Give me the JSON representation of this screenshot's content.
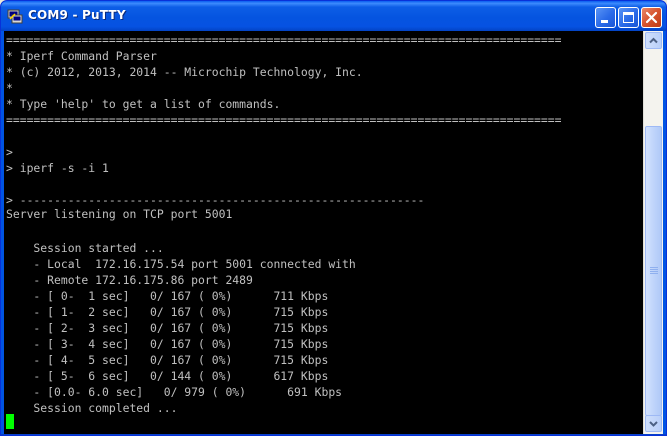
{
  "window": {
    "title": "COM9 - PuTTY"
  },
  "terminal": {
    "lines": [
      "=================================================================================",
      "* Iperf Command Parser",
      "* (c) 2012, 2013, 2014 -- Microchip Technology, Inc.",
      "*",
      "* Type 'help' to get a list of commands.",
      "=================================================================================",
      "",
      "",
      ">",
      "> iperf -s -i 1",
      "",
      "> -----------------------------------------------------------",
      "Server listening on TCP port 5001",
      "",
      "    Session started ...",
      "    - Local  172.16.175.54 port 5001 connected with",
      "    - Remote 172.16.175.86 port 2489",
      "    - [ 0-  1 sec]   0/ 167 ( 0%)      711 Kbps",
      "    - [ 1-  2 sec]   0/ 167 ( 0%)      715 Kbps",
      "    - [ 2-  3 sec]   0/ 167 ( 0%)      715 Kbps",
      "    - [ 3-  4 sec]   0/ 167 ( 0%)      715 Kbps",
      "    - [ 4-  5 sec]   0/ 167 ( 0%)      715 Kbps",
      "    - [ 5-  6 sec]   0/ 144 ( 0%)      617 Kbps",
      "    - [0.0- 6.0 sec]   0/ 979 ( 0%)      691 Kbps",
      "    Session completed ..."
    ]
  },
  "colors": {
    "terminal_bg": "#000000",
    "terminal_fg": "#c0c0c0",
    "cursor": "#00ff00",
    "titlebar": "#0554e0"
  }
}
